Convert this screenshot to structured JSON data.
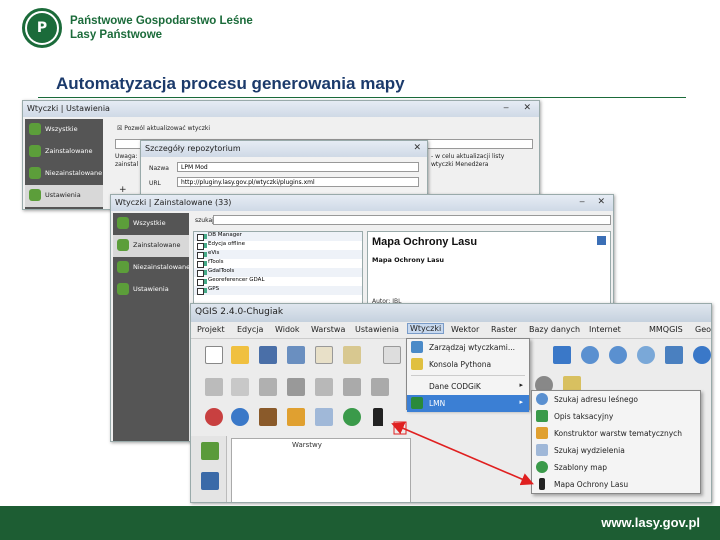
{
  "header": {
    "logo_text": "LASY PAŃSTWOWE",
    "org_line1": "Państwowe Gospodarstwo Leśne",
    "org_line2": "Lasy Państwowe",
    "slide_title": "Automatyzacja procesu generowania mapy"
  },
  "footer": {
    "url": "www.lasy.gov.pl"
  },
  "plugins_window_1": {
    "title": "Wtyczki | Ustawienia",
    "sidebar": [
      "Wszystkie",
      "Zainstalowane",
      "Niezainstalowane",
      "Ustawienia"
    ],
    "checkbox_label": "Pozwól aktualizować wtyczki",
    "text_left": [
      "Uwaga:",
      "zainstal"
    ],
    "text_right": [
      "- w celu aktualizacji listy",
      "wtyczki Menedżera"
    ],
    "icon_plus": "+"
  },
  "repo_dialog": {
    "title": "Szczegóły repozytorium",
    "name_label": "Nazwa",
    "name_value": "LPM Mod",
    "url_label": "URL",
    "url_value": "http://pluginy.lasy.gov.pl/wtyczki/plugins.xml"
  },
  "plugins_window_2": {
    "title": "Wtyczki | Zainstalowane (33)",
    "sidebar": [
      "Wszystkie",
      "Zainstalowane",
      "Niezainstalowane",
      "Ustawienia"
    ],
    "search_label": "szukaj",
    "plugin_items": [
      "DB Manager",
      "Edycja offline",
      "eVis",
      "fTools",
      "GdalTools",
      "Georeferencer GDAL",
      "GPS"
    ],
    "detail_title": "Mapa Ochrony Lasu",
    "detail_subtitle": "Mapa Ochrony Lasu",
    "detail_footer": "Autor: IBL"
  },
  "qgis": {
    "title": "QGIS 2.4.0-Chugiak",
    "menu": [
      "Projekt",
      "Edycja",
      "Widok",
      "Warstwa",
      "Ustawienia",
      "Wtyczki",
      "Wektor",
      "Raster",
      "Bazy danych",
      "Internet",
      "MMQGIS",
      "Geo"
    ],
    "layers_panel": "Warstwy"
  },
  "wtyczki_menu": {
    "items": [
      "Zarządzaj wtyczkami...",
      "Konsola Pythona",
      "Dane CODGiK",
      "LMN"
    ],
    "submenu_marker": "▸"
  },
  "lmn_submenu": {
    "items": [
      "Szukaj adresu leśnego",
      "Opis taksacyjny",
      "Konstruktor warstw tematycznych",
      "Szukaj wydzielenia",
      "Szablony map",
      "Mapa Ochrony Lasu"
    ]
  },
  "colors": {
    "brand_green": "#1d5d33",
    "title_blue": "#1b3a6b",
    "arrow_red": "#e02020",
    "highlight": "#3b7fd4"
  }
}
